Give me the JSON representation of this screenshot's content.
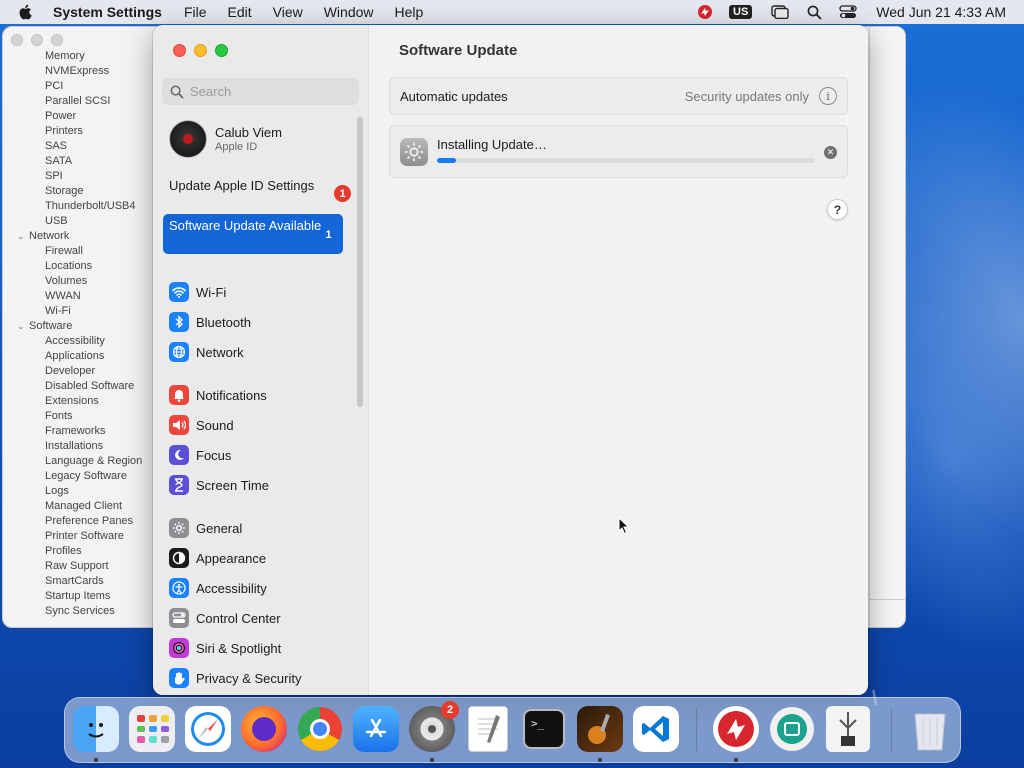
{
  "menubar": {
    "app_name": "System Settings",
    "menus": [
      "File",
      "Edit",
      "View",
      "Window",
      "Help"
    ],
    "keyboard_layout": "US",
    "clock": "Wed Jun 21  4:33 AM"
  },
  "background_window": {
    "items": [
      {
        "label": "Memory",
        "kind": "child"
      },
      {
        "label": "NVMExpress",
        "kind": "child"
      },
      {
        "label": "PCI",
        "kind": "child"
      },
      {
        "label": "Parallel SCSI",
        "kind": "child"
      },
      {
        "label": "Power",
        "kind": "child"
      },
      {
        "label": "Printers",
        "kind": "child"
      },
      {
        "label": "SAS",
        "kind": "child"
      },
      {
        "label": "SATA",
        "kind": "child"
      },
      {
        "label": "SPI",
        "kind": "child"
      },
      {
        "label": "Storage",
        "kind": "child"
      },
      {
        "label": "Thunderbolt/USB4",
        "kind": "child"
      },
      {
        "label": "USB",
        "kind": "child"
      },
      {
        "label": "Network",
        "kind": "group"
      },
      {
        "label": "Firewall",
        "kind": "child"
      },
      {
        "label": "Locations",
        "kind": "child"
      },
      {
        "label": "Volumes",
        "kind": "child"
      },
      {
        "label": "WWAN",
        "kind": "child"
      },
      {
        "label": "Wi-Fi",
        "kind": "child"
      },
      {
        "label": "Software",
        "kind": "group"
      },
      {
        "label": "Accessibility",
        "kind": "child"
      },
      {
        "label": "Applications",
        "kind": "child"
      },
      {
        "label": "Developer",
        "kind": "child"
      },
      {
        "label": "Disabled Software",
        "kind": "child"
      },
      {
        "label": "Extensions",
        "kind": "child"
      },
      {
        "label": "Fonts",
        "kind": "child"
      },
      {
        "label": "Frameworks",
        "kind": "child"
      },
      {
        "label": "Installations",
        "kind": "child"
      },
      {
        "label": "Language & Region",
        "kind": "child"
      },
      {
        "label": "Legacy Software",
        "kind": "child"
      },
      {
        "label": "Logs",
        "kind": "child"
      },
      {
        "label": "Managed Client",
        "kind": "child"
      },
      {
        "label": "Preference Panes",
        "kind": "child"
      },
      {
        "label": "Printer Software",
        "kind": "child"
      },
      {
        "label": "Profiles",
        "kind": "child"
      },
      {
        "label": "Raw Support",
        "kind": "child"
      },
      {
        "label": "SmartCards",
        "kind": "child"
      },
      {
        "label": "Startup Items",
        "kind": "child"
      },
      {
        "label": "Sync Services",
        "kind": "child"
      }
    ]
  },
  "sidebar": {
    "search_placeholder": "Search",
    "profile": {
      "name": "Calub Viem",
      "subtitle": "Apple ID"
    },
    "notices": [
      {
        "label": "Update Apple ID Settings",
        "badge": "1",
        "selected": false
      },
      {
        "label": "Software Update Available",
        "badge": "1",
        "selected": true
      }
    ],
    "items": [
      {
        "label": "Wi-Fi",
        "icon": "wifi-icon",
        "color": "#1a82fb"
      },
      {
        "label": "Bluetooth",
        "icon": "bluetooth-icon",
        "color": "#1a82fb"
      },
      {
        "label": "Network",
        "icon": "globe-icon",
        "color": "#1a82fb"
      },
      {
        "label": "Notifications",
        "icon": "bell-icon",
        "color": "#f0453a"
      },
      {
        "label": "Sound",
        "icon": "speaker-icon",
        "color": "#f0453a"
      },
      {
        "label": "Focus",
        "icon": "moon-icon",
        "color": "#5b4fd6"
      },
      {
        "label": "Screen Time",
        "icon": "hourglass-icon",
        "color": "#5b4fd6"
      },
      {
        "label": "General",
        "icon": "gear-icon",
        "color": "#8e8e93"
      },
      {
        "label": "Appearance",
        "icon": "appearance-icon",
        "color": "#1b1b1b"
      },
      {
        "label": "Accessibility",
        "icon": "accessibility-icon",
        "color": "#1a82fb"
      },
      {
        "label": "Control Center",
        "icon": "toggles-icon",
        "color": "#8e8e93"
      },
      {
        "label": "Siri & Spotlight",
        "icon": "siri-icon",
        "color": "#c13bd6"
      },
      {
        "label": "Privacy & Security",
        "icon": "hand-icon",
        "color": "#1a82fb"
      }
    ]
  },
  "content": {
    "title": "Software Update",
    "automatic_updates_label": "Automatic updates",
    "automatic_updates_value": "Security updates only",
    "install_status": "Installing Update…",
    "progress": 0.05
  },
  "dock": {
    "apps": [
      {
        "name": "Finder",
        "icon": "finder-icon"
      },
      {
        "name": "Launchpad",
        "icon": "launchpad-icon"
      },
      {
        "name": "Safari",
        "icon": "safari-icon"
      },
      {
        "name": "Firefox",
        "icon": "firefox-icon"
      },
      {
        "name": "Chrome",
        "icon": "chrome-icon"
      },
      {
        "name": "App Store",
        "icon": "app-store-icon"
      },
      {
        "name": "System Settings",
        "icon": "system-settings-icon",
        "badge": "2"
      },
      {
        "name": "TextEdit",
        "icon": "textedit-icon"
      },
      {
        "name": "Terminal",
        "icon": "terminal-icon"
      },
      {
        "name": "Instruments",
        "icon": "instruments-icon"
      },
      {
        "name": "VS Code",
        "icon": "vscode-icon"
      },
      {
        "name": "Server",
        "icon": "server-icon"
      },
      {
        "name": "Archive",
        "icon": "archive-icon"
      },
      {
        "name": "USB Utility",
        "icon": "usb-icon"
      },
      {
        "name": "Trash",
        "icon": "trash-icon"
      }
    ]
  }
}
